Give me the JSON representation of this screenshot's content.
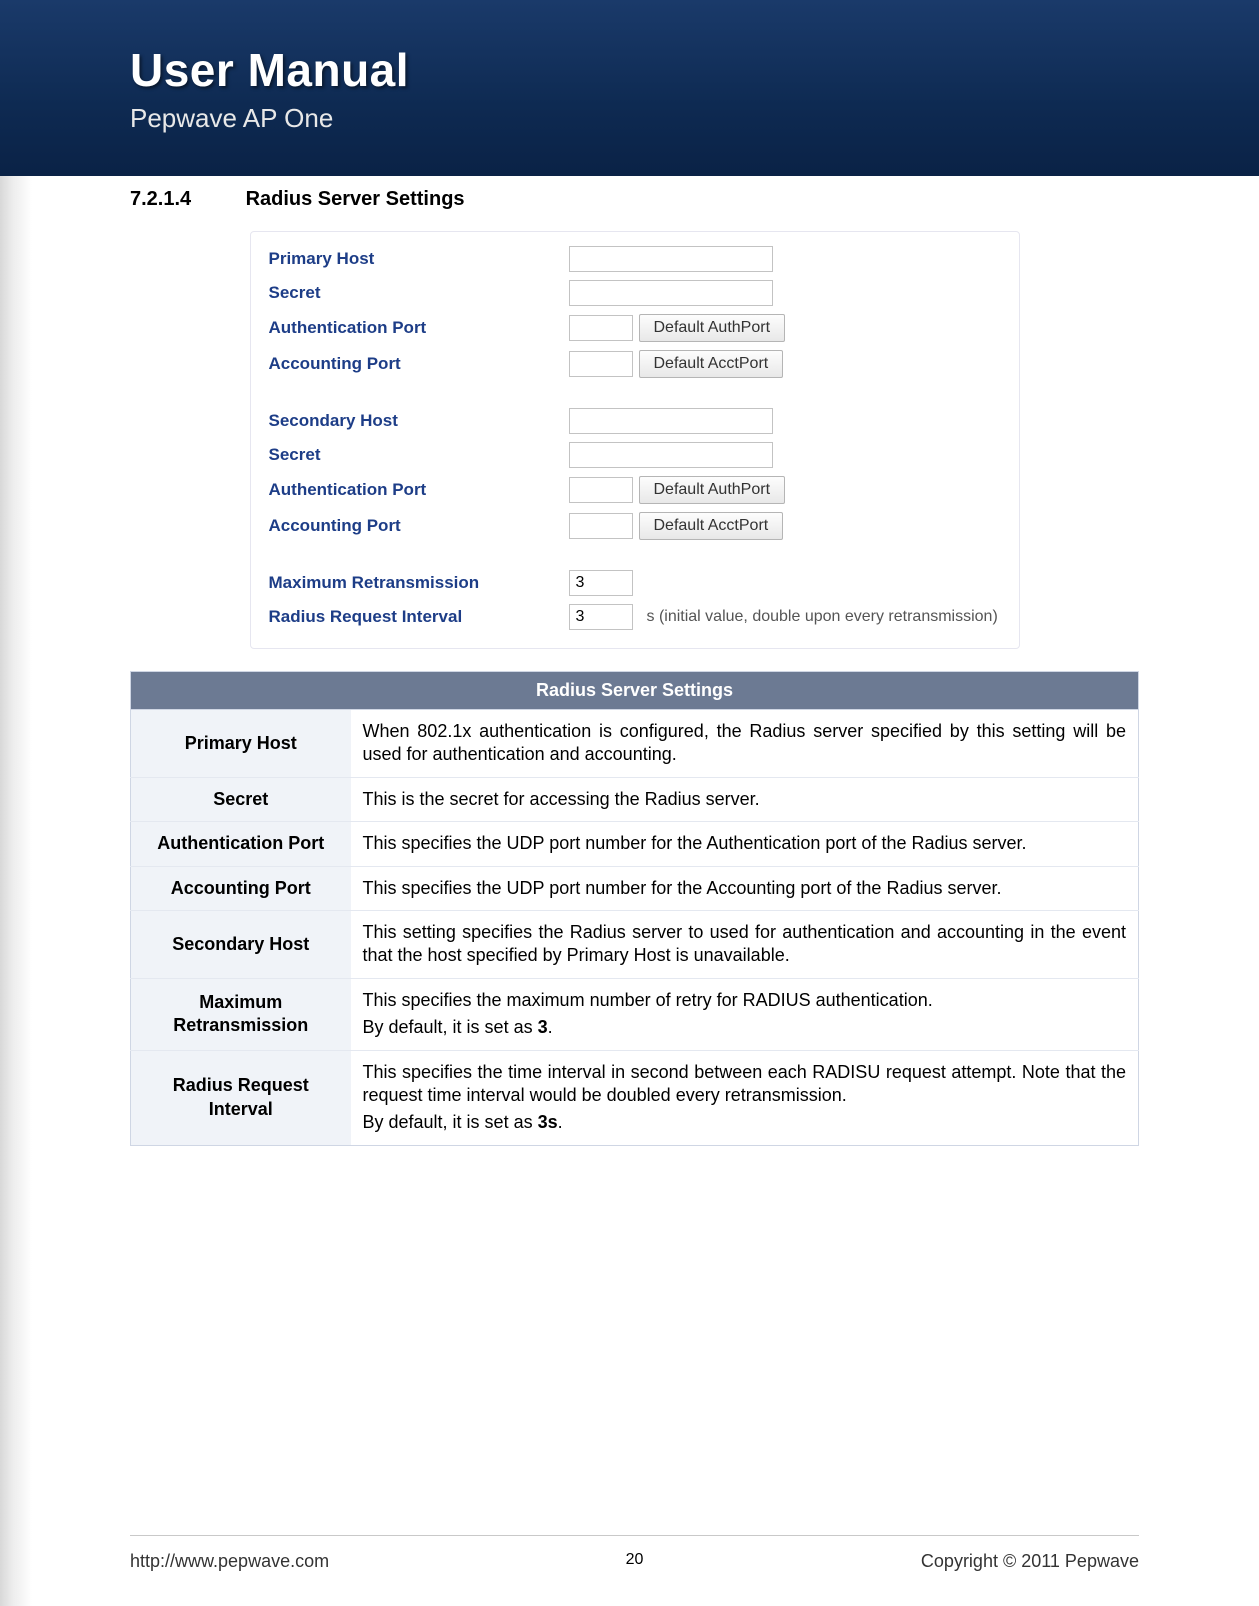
{
  "header": {
    "title": "User Manual",
    "subtitle": "Pepwave AP One"
  },
  "section": {
    "number": "7.2.1.4",
    "title": "Radius Server Settings"
  },
  "form": {
    "group1": {
      "primary_host_label": "Primary Host",
      "secret_label": "Secret",
      "auth_port_label": "Authentication Port",
      "acct_port_label": "Accounting Port",
      "default_auth_btn": "Default AuthPort",
      "default_acct_btn": "Default AcctPort"
    },
    "group2": {
      "secondary_host_label": "Secondary Host",
      "secret_label": "Secret",
      "auth_port_label": "Authentication Port",
      "acct_port_label": "Accounting Port",
      "default_auth_btn": "Default AuthPort",
      "default_acct_btn": "Default AcctPort"
    },
    "group3": {
      "max_retrans_label": "Maximum Retransmission",
      "max_retrans_value": "3",
      "req_interval_label": "Radius Request Interval",
      "req_interval_value": "3",
      "req_interval_hint": "s (initial value, double upon every retransmission)"
    }
  },
  "table": {
    "header": "Radius Server Settings",
    "rows": {
      "primary_host": {
        "label": "Primary Host",
        "text": "When 802.1x authentication is configured, the Radius server specified by this setting will be used for authentication and accounting."
      },
      "secret": {
        "label": "Secret",
        "text": "This is the secret for accessing the Radius server."
      },
      "auth_port": {
        "label": "Authentication Port",
        "text": "This specifies the UDP port number for the Authentication port of the Radius server."
      },
      "acct_port": {
        "label": "Accounting Port",
        "text": "This specifies the UDP port number for the Accounting port of the Radius server."
      },
      "secondary_host": {
        "label": "Secondary Host",
        "text": "This setting specifies the Radius server to used for authentication and accounting in the event that the host specified by Primary Host is unavailable."
      },
      "max_retrans": {
        "label": "Maximum Retransmission",
        "text1": "This specifies the maximum number of retry for RADIUS authentication.",
        "text2_pre": "By default, it is set as ",
        "text2_bold": "3",
        "text2_post": "."
      },
      "req_interval": {
        "label": "Radius Request Interval",
        "text1": "This specifies the time interval in second between each RADISU request attempt.  Note that the request time interval would be doubled every retransmission.",
        "text2_pre": "By default, it is set as ",
        "text2_bold": "3s",
        "text2_post": "."
      }
    }
  },
  "footer": {
    "url": "http://www.pepwave.com",
    "page": "20",
    "copyright": "Copyright © 2011 Pepwave"
  }
}
